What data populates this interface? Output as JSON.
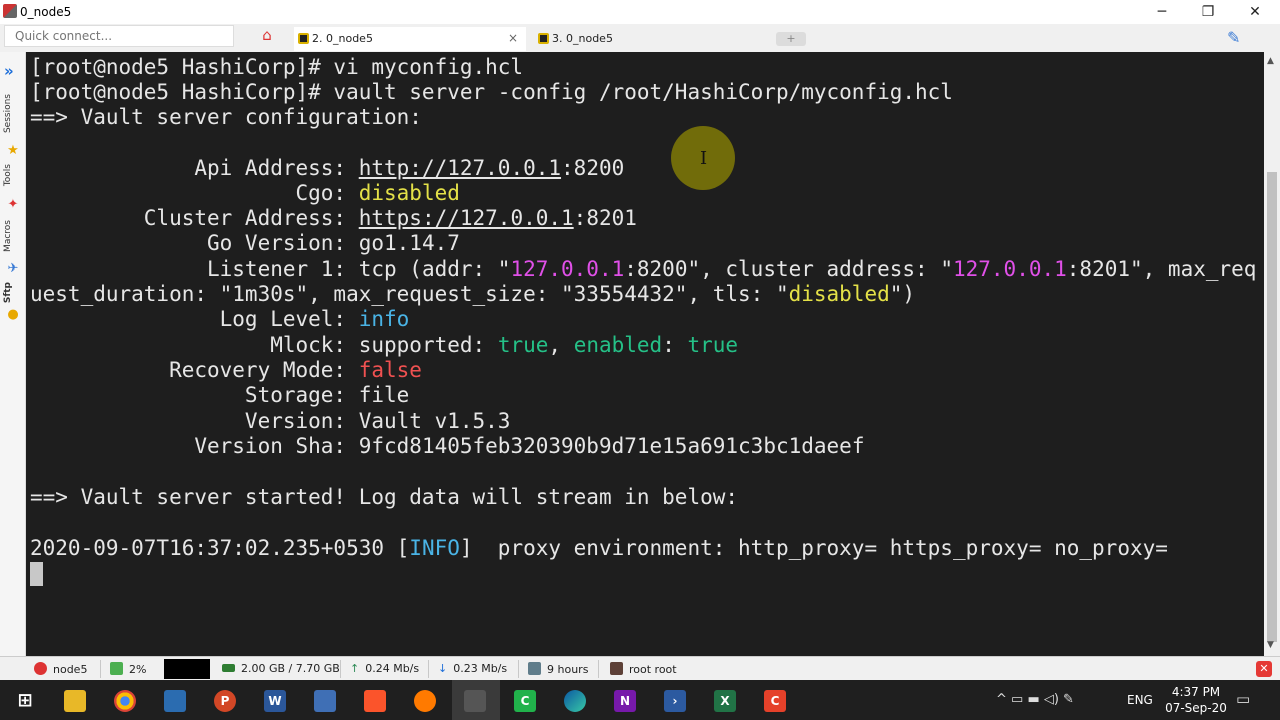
{
  "window": {
    "title": "0_node5",
    "minimize": "─",
    "maximize": "❐",
    "close": "✕"
  },
  "toolbar": {
    "quick_connect_placeholder": "Quick connect..."
  },
  "tabs": [
    {
      "label": "2. 0_node5",
      "close": "×"
    },
    {
      "label": "3. 0_node5"
    }
  ],
  "sidebar": {
    "sessions": "Sessions",
    "tools": "Tools",
    "macros": "Macros",
    "sftp": "Sftp"
  },
  "terminal": {
    "line1": "[root@node5 HashiCorp]# vi myconfig.hcl",
    "line2": "[root@node5 HashiCorp]# vault server -config /root/HashiCorp/myconfig.hcl",
    "line3": "==> Vault server configuration:",
    "api_label": "             Api Address: ",
    "api_url": "http://127.0.0.1",
    "api_port": ":8200",
    "cgo_label": "                     Cgo: ",
    "cgo_value": "disabled",
    "cluster_label": "         Cluster Address: ",
    "cluster_url": "https://127.0.0.1",
    "cluster_port": ":8201",
    "go_label": "              Go Version: ",
    "go_value": "go1.14.7",
    "listener_label": "              Listener 1: ",
    "listener_a": "tcp (addr: \"",
    "listener_ip1": "127.0.0.1",
    "listener_b": ":8200\", cluster address: \"",
    "listener_ip2": "127.0.0.1",
    "listener_c": ":8201\", max_req",
    "listener_d": "uest_duration: \"1m30s\", max_request_size: \"33554432\", tls: \"",
    "listener_tls": "disabled",
    "listener_e": "\")",
    "log_label": "               Log Level: ",
    "log_value": "info",
    "mlock_label": "                   Mlock: ",
    "mlock_a": "supported: ",
    "mlock_true1": "true",
    "mlock_b": ", ",
    "mlock_enabled": "enabled",
    "mlock_c": ": ",
    "mlock_true2": "true",
    "recovery_label": "           Recovery Mode: ",
    "recovery_value": "false",
    "storage_label": "                 Storage: ",
    "storage_value": "file",
    "version_label": "                 Version: ",
    "version_value": "Vault v1.5.3",
    "sha_label": "             Version Sha: ",
    "sha_value": "9fcd81405feb320390b9d71e15a691c3bc1daeef",
    "started": "==> Vault server started! Log data will stream in below:",
    "log_time": "2020-09-07T16:37:02.235+0530 [",
    "log_level": "INFO",
    "log_msg": "]  proxy environment: http_proxy= https_proxy= no_proxy="
  },
  "status": {
    "host": "node5",
    "cpu": "2%",
    "memory": "2.00 GB / 7.70 GB",
    "upload": "0.24 Mb/s",
    "download": "0.23 Mb/s",
    "uptime": "9 hours",
    "user": "root  root"
  },
  "taskbar": {
    "lang": "ENG",
    "time": "4:37 PM",
    "date": "07-Sep-20"
  },
  "colors": {
    "terminal_bg": "#1e1e1e",
    "yellow": "#e4e148",
    "magenta": "#e050e8",
    "cyan": "#4ab4e6",
    "green": "#25c087",
    "red": "#f05151"
  },
  "icons": [
    "home-icon",
    "clip-icon",
    "search-icon",
    "windows-start-icon",
    "chrome-icon",
    "powerpoint-icon",
    "word-icon",
    "brave-icon",
    "edge-icon",
    "onenote-icon",
    "powershell-icon",
    "excel-icon",
    "camtasia-icon"
  ]
}
